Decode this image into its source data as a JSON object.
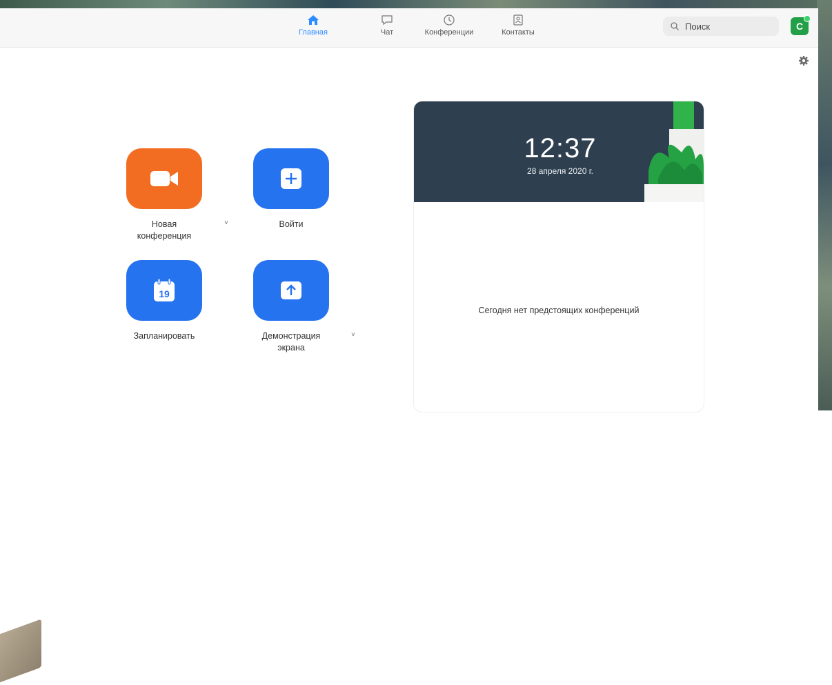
{
  "nav": {
    "tabs": [
      {
        "label": "Главная",
        "icon": "home-icon",
        "active": true
      },
      {
        "label": "Чат",
        "icon": "chat-icon",
        "active": false
      },
      {
        "label": "Конференции",
        "icon": "clock-icon",
        "active": false
      },
      {
        "label": "Контакты",
        "icon": "contacts-icon",
        "active": false
      }
    ]
  },
  "search": {
    "placeholder": "Поиск"
  },
  "avatar": {
    "initial": "С",
    "status_color": "#3ad36b"
  },
  "actions": [
    {
      "label": "Новая конференция",
      "icon": "video-camera-icon",
      "color": "#f26d21",
      "has_dropdown": true
    },
    {
      "label": "Войти",
      "icon": "plus-icon",
      "color": "#2673f0",
      "has_dropdown": false
    },
    {
      "label": "Запланировать",
      "icon": "calendar-icon",
      "calendar_day": "19",
      "color": "#2673f0",
      "has_dropdown": false
    },
    {
      "label": "Демонстрация экрана",
      "icon": "share-up-arrow-icon",
      "color": "#2673f0",
      "has_dropdown": true
    }
  ],
  "dropdown_glyph": "˅",
  "clock_card": {
    "time": "12:37",
    "date": "28 апреля 2020 г.",
    "empty_message": "Сегодня нет предстоящих конференций"
  },
  "colors": {
    "accent": "#2d8cff",
    "orange": "#f26d21",
    "blue": "#2673f0",
    "hero": "#2e3f4f"
  }
}
